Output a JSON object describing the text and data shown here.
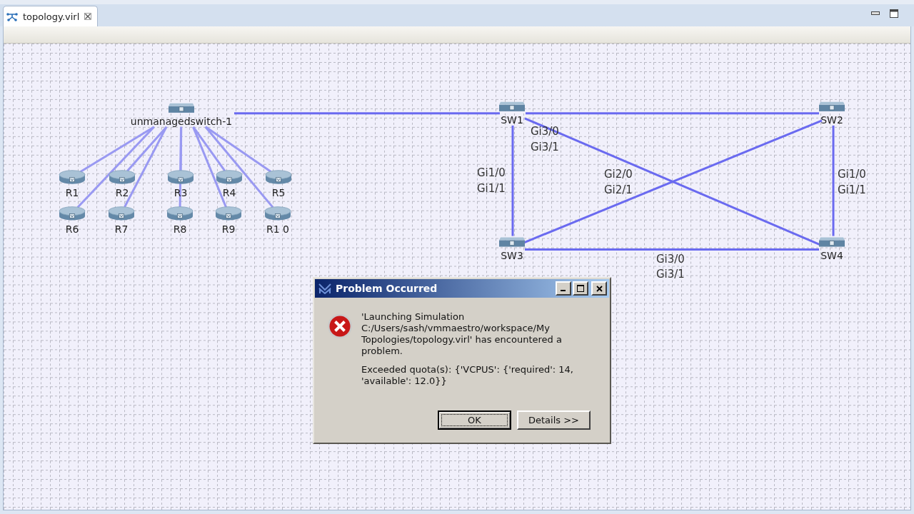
{
  "editor_tab": {
    "label": "topology.virl",
    "selected": true
  },
  "nodes": [
    {
      "kind": "switch",
      "name": "unmanagedswitch-1"
    },
    {
      "kind": "router",
      "name": "R1"
    },
    {
      "kind": "router",
      "name": "R2"
    },
    {
      "kind": "router",
      "name": "R3"
    },
    {
      "kind": "router",
      "name": "R4"
    },
    {
      "kind": "router",
      "name": "R5"
    },
    {
      "kind": "router",
      "name": "R6"
    },
    {
      "kind": "router",
      "name": "R7"
    },
    {
      "kind": "router",
      "name": "R8"
    },
    {
      "kind": "router",
      "name": "R9"
    },
    {
      "kind": "router",
      "name": "R1 0"
    },
    {
      "kind": "switch",
      "name": "SW1"
    },
    {
      "kind": "switch",
      "name": "SW2"
    },
    {
      "kind": "switch",
      "name": "SW3"
    },
    {
      "kind": "switch",
      "name": "SW4"
    }
  ],
  "link_labels": [
    {
      "lines": [
        "Gi3/0",
        "Gi3/1"
      ]
    },
    {
      "lines": [
        "Gi1/0",
        "Gi1/1"
      ]
    },
    {
      "lines": [
        "Gi2/0",
        "Gi2/1"
      ]
    },
    {
      "lines": [
        "Gi1/0",
        "Gi1/1"
      ]
    },
    {
      "lines": [
        "Gi3/0",
        "Gi3/1"
      ]
    }
  ],
  "dialog": {
    "title": "Problem Occurred",
    "message": "'Launching Simulation C:/Users/sash/vmmaestro/workspace/My Topologies/topology.virl' has encountered a problem.",
    "detail": "Exceeded quota(s): {'VCPUS': {'required': 14, 'available': 12.0}}",
    "buttons": [
      {
        "label": "OK",
        "focused": true
      },
      {
        "label": "Details >>",
        "focused": false
      }
    ]
  }
}
